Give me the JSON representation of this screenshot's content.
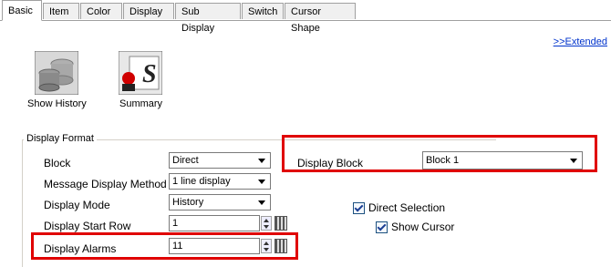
{
  "tabs": [
    "Basic",
    "Item",
    "Color",
    "Display",
    "Sub Display",
    "Switch",
    "Cursor Shape"
  ],
  "extended_link": ">>Extended",
  "icons": {
    "show_history_label": "Show History",
    "summary_label": "Summary"
  },
  "display_format": {
    "title": "Display Format",
    "block_label": "Block",
    "block_value": "Direct",
    "message_method_label": "Message Display Method",
    "message_method_value": "1 line display",
    "display_mode_label": "Display Mode",
    "display_mode_value": "History",
    "start_row_label": "Display Start Row",
    "start_row_value": "1",
    "alarms_label": "Display Alarms",
    "alarms_value": "11",
    "display_block_label": "Display Block",
    "display_block_value": "Block 1",
    "direct_selection_label": "Direct Selection",
    "direct_selection_checked": true,
    "show_cursor_label": "Show Cursor",
    "show_cursor_checked": true
  },
  "colors": {
    "highlight": "#e00000",
    "link": "#0033cc"
  }
}
